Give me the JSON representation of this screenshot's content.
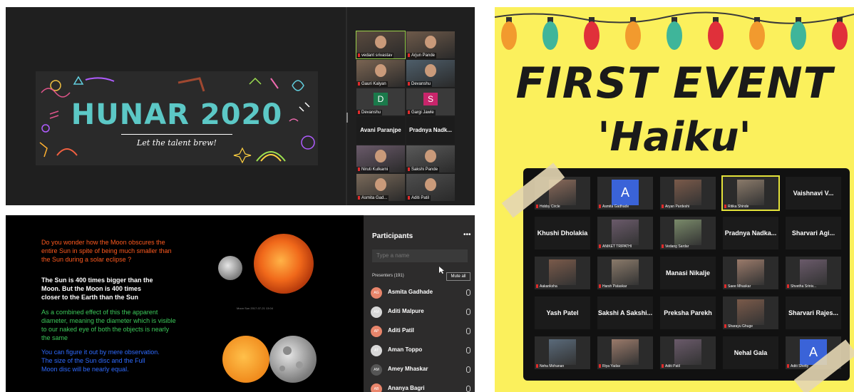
{
  "zoom_hunar": {
    "banner_title": "HUNAR 2020",
    "banner_tagline": "Let the talent brew!",
    "participants": [
      {
        "name": "vedant srivastav",
        "type": "video"
      },
      {
        "name": "Arjun Pande",
        "type": "video"
      },
      {
        "name": "Gauri Kalyan",
        "type": "video"
      },
      {
        "name": "Devanshu",
        "type": "video"
      },
      {
        "name": "Devanshu",
        "type": "initial",
        "initial": "D",
        "color": "#1b7a4b"
      },
      {
        "name": "Gargi Jawle",
        "type": "initial",
        "initial": "S",
        "color": "#c8256b"
      },
      {
        "name": "Avani Paranjpe",
        "type": "name"
      },
      {
        "name": "Pradnya Nadk...",
        "type": "name"
      },
      {
        "name": "Niruti Kulkarni",
        "type": "video"
      },
      {
        "name": "Sakshi Pande",
        "type": "video"
      },
      {
        "name": "Asmita Gad...",
        "type": "video"
      },
      {
        "name": "Aditi Patil",
        "type": "video"
      }
    ]
  },
  "teams_slide": {
    "question": "Do you wonder how the Moon obscures the entire Sun in spite of being much smaller than the Sun during a solar eclipse ?",
    "fact": "The Sun is 400 times bigger than the Moon. But the Moon is 400 times closer to the Earth than the Sun",
    "effect": "As a combined effect of this the apparent diameter, meaning the diameter which is visible to our naked eye  of both the objects is nearly the same",
    "observe": "You can figure it out by mere observation.  The size of the Sun disc and the Full Moon disc will be nearly equal.",
    "photo_caption": "Moon  Sun  2017-07-21 13:04",
    "colors": {
      "question": "#ff5a1f",
      "fact": "#ffffff",
      "effect": "#3cc95a",
      "observe": "#2f6bff"
    },
    "sidebar": {
      "title": "Participants",
      "more": "•••",
      "search_placeholder": "Type a name",
      "presenters_label": "Presenters (191)",
      "mute_all": "Mute all",
      "people": [
        {
          "name": "Asmita Gadhade",
          "initials": "AG"
        },
        {
          "name": "Aditi Malpure",
          "initials": "AM"
        },
        {
          "name": "Aditi Patil",
          "initials": "AP"
        },
        {
          "name": "Aman Toppo",
          "initials": "AT"
        },
        {
          "name": "Amey Mhaskar",
          "initials": "AM"
        },
        {
          "name": "Ananya Bagri",
          "initials": "AB"
        }
      ]
    }
  },
  "poster": {
    "title": "FIRST EVENT",
    "subtitle": "'Haiku'",
    "grid": [
      {
        "name": "Hobby Circle",
        "type": "video"
      },
      {
        "name": "Asmita Gadhade",
        "type": "initial",
        "initial": "A"
      },
      {
        "name": "Aryan Pardeshi",
        "type": "video"
      },
      {
        "name": "Ritika Shinde",
        "type": "video"
      },
      {
        "name": "Vaishnavi V...",
        "type": "name"
      },
      {
        "name": "Khushi Dholakia",
        "type": "name"
      },
      {
        "name": "ANIKET TRIPATHI",
        "type": "video"
      },
      {
        "name": "Vedang Sardar",
        "type": "video"
      },
      {
        "name": "Pradnya Nadka...",
        "type": "name"
      },
      {
        "name": "Sharvari Agi...",
        "type": "name"
      },
      {
        "name": "Aakanksha",
        "type": "video"
      },
      {
        "name": "Harsh Pataskar",
        "type": "video"
      },
      {
        "name": "Manasi Nikalje",
        "type": "name"
      },
      {
        "name": "Saee Mhaskar",
        "type": "video"
      },
      {
        "name": "Shvetha Sriniv...",
        "type": "video"
      },
      {
        "name": "Yash Patel",
        "type": "name"
      },
      {
        "name": "Sakshi A Sakshi...",
        "type": "name"
      },
      {
        "name": "Preksha Parekh",
        "type": "name"
      },
      {
        "name": "Sharayu Ghuge",
        "type": "video"
      },
      {
        "name": "Sharvari Rajes...",
        "type": "name"
      },
      {
        "name": "Neha Mohanan",
        "type": "video"
      },
      {
        "name": "Riya Yadav",
        "type": "video"
      },
      {
        "name": "Aditi Patil",
        "type": "video"
      },
      {
        "name": "Nehal Gala",
        "type": "name"
      },
      {
        "name": "Aditi Shetty",
        "type": "initial",
        "initial": "A"
      }
    ]
  }
}
